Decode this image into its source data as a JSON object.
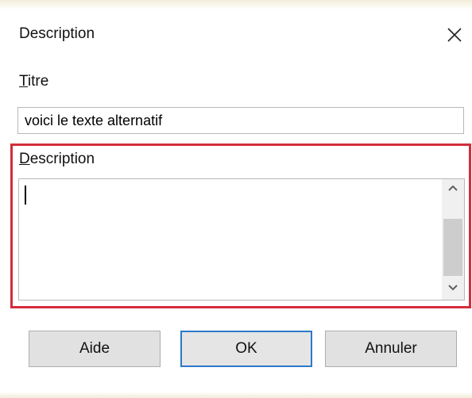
{
  "window": {
    "title": "Description",
    "close_icon": "close-icon"
  },
  "titre": {
    "label": "Titre",
    "value": "voici le texte alternatif"
  },
  "description": {
    "label": "Description",
    "value": "",
    "scroll_up_icon": "chevron-up-icon",
    "scroll_down_icon": "chevron-down-icon"
  },
  "buttons": {
    "aide": "Aide",
    "ok": "OK",
    "annuler": "Annuler"
  },
  "colors": {
    "highlight": "#d42d3a",
    "default_button_border": "#2b79c9"
  }
}
